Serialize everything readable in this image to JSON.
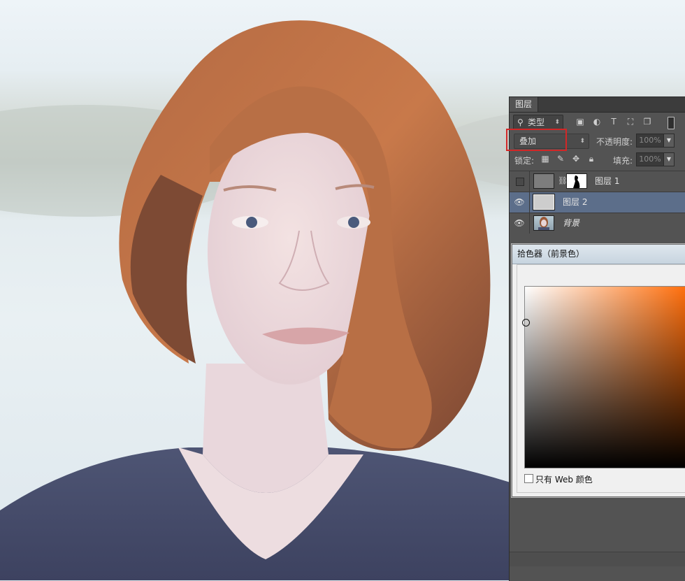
{
  "layers_panel": {
    "tab": "图层",
    "filter": {
      "kind_label": "类型",
      "icons": [
        "image-filter-icon",
        "adjustment-filter-icon",
        "type-filter-icon",
        "shape-filter-icon",
        "smart-object-filter-icon"
      ]
    },
    "blend_mode": "叠加",
    "opacity_label": "不透明度:",
    "opacity_value": "100%",
    "lock_label": "锁定:",
    "fill_label": "填充:",
    "fill_value": "100%",
    "layers": [
      {
        "name": "图层 1",
        "visible": false,
        "selected": false
      },
      {
        "name": "图层 2",
        "visible": true,
        "selected": true
      },
      {
        "name": "背景",
        "visible": true,
        "selected": false
      }
    ]
  },
  "color_picker": {
    "title": "拾色器（前景色）",
    "web_only_label": "只有 Web 颜色",
    "hue_color": "#ff6b06"
  }
}
